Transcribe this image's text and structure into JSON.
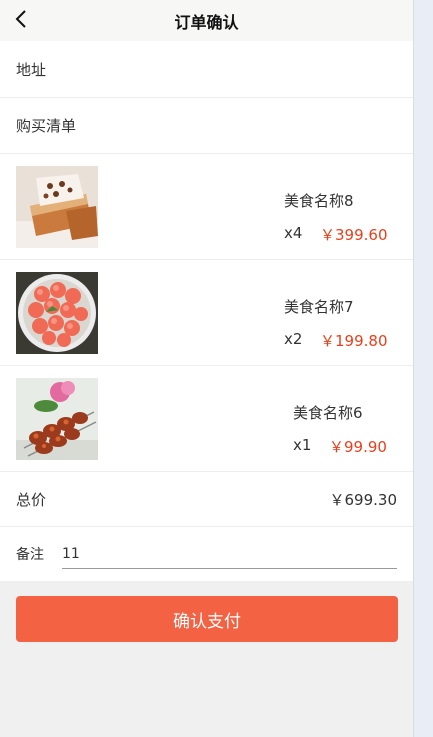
{
  "header": {
    "title": "订单确认",
    "back_icon": "chevron-left-icon"
  },
  "address": {
    "label": "地址"
  },
  "shopping_list": {
    "label": "购买清单"
  },
  "items": [
    {
      "name": "美食名称8",
      "qty": "x4",
      "price": "￥399.60",
      "image": "cake-slice"
    },
    {
      "name": "美食名称7",
      "qty": "x2",
      "price": "￥199.80",
      "image": "melon-balls"
    },
    {
      "name": "美食名称6",
      "qty": "x1",
      "price": "￥99.90",
      "image": "grilled-skewers"
    }
  ],
  "total": {
    "label": "总价",
    "value": "￥699.30"
  },
  "note": {
    "label": "备注",
    "value": "11"
  },
  "pay_button": {
    "label": "确认支付"
  },
  "colors": {
    "accent": "#f26243",
    "price": "#e8401c"
  }
}
